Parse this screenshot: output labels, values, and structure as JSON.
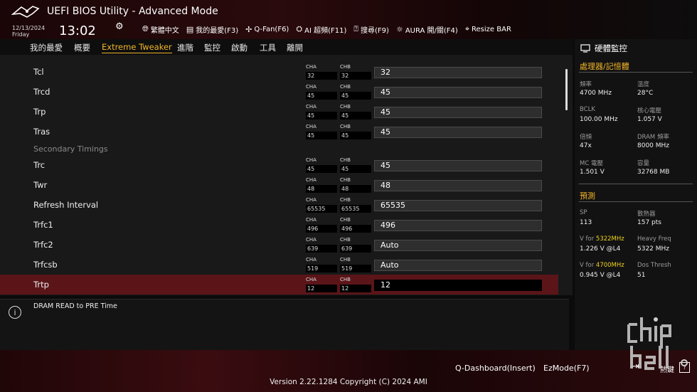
{
  "header": {
    "title": "UEFI BIOS Utility - Advanced Mode",
    "date": "12/13/2024",
    "day": "Friday",
    "time": "13:02",
    "toolbar": [
      {
        "icon": "globe-icon",
        "label": "繁體中文"
      },
      {
        "icon": "favorites-icon",
        "label": "我的最愛(F3)"
      },
      {
        "icon": "fan-icon",
        "label": "Q-Fan(F6)"
      },
      {
        "icon": "ai-overclock-icon",
        "label": "AI 超頻(F11)"
      },
      {
        "icon": "help-search-icon",
        "label": "搜尋(F9)"
      },
      {
        "icon": "aura-icon",
        "label": "AURA 開/關(F4)"
      },
      {
        "icon": "resize-bar-icon",
        "label": "Resize BAR"
      }
    ]
  },
  "menu": {
    "items": [
      "我的最愛",
      "概要",
      "Extreme Tweaker",
      "進階",
      "監控",
      "啟動",
      "工具",
      "離開"
    ],
    "active": "Extreme Tweaker"
  },
  "main": {
    "channel_a": "CHA",
    "channel_b": "CHB",
    "section_label": "Secondary Timings",
    "rows": [
      {
        "label": "Tcl",
        "cha": "32",
        "chb": "32",
        "value": "32"
      },
      {
        "label": "Trcd",
        "cha": "45",
        "chb": "45",
        "value": "45"
      },
      {
        "label": "Trp",
        "cha": "45",
        "chb": "45",
        "value": "45"
      },
      {
        "label": "Tras",
        "cha": "45",
        "chb": "45",
        "value": "45"
      },
      {
        "label": "Trc",
        "cha": "45",
        "chb": "45",
        "value": "45"
      },
      {
        "label": "Twr",
        "cha": "48",
        "chb": "48",
        "value": "48"
      },
      {
        "label": "Refresh Interval",
        "cha": "65535",
        "chb": "65535",
        "value": "65535"
      },
      {
        "label": "Trfc1",
        "cha": "496",
        "chb": "496",
        "value": "496"
      },
      {
        "label": "Trfc2",
        "cha": "639",
        "chb": "639",
        "value": "Auto"
      },
      {
        "label": "Trfcsb",
        "cha": "519",
        "chb": "519",
        "value": "Auto"
      },
      {
        "label": "Trtp",
        "cha": "12",
        "chb": "12",
        "value": "12"
      }
    ],
    "selected_row": "Trtp"
  },
  "description": "DRAM READ to PRE Time",
  "monitor": {
    "title": "硬體監控",
    "cpu_section": "處理器/記憶體",
    "cpu_items": [
      {
        "label": "頻率",
        "value": "4700 MHz"
      },
      {
        "label": "溫度",
        "value": "28°C"
      },
      {
        "label": "BCLK",
        "value": "100.00 MHz"
      },
      {
        "label": "核心電壓",
        "value": "1.057 V"
      },
      {
        "label": "倍頻",
        "value": "47x"
      },
      {
        "label": "DRAM 頻率",
        "value": "8000 MHz"
      },
      {
        "label": "MC 電壓",
        "value": "1.501 V"
      },
      {
        "label": "容量",
        "value": "32768 MB"
      }
    ],
    "predict_section": "預測",
    "predict_items": [
      {
        "label": "SP",
        "value": "113"
      },
      {
        "label": "散熱器",
        "value": "157 pts"
      },
      {
        "label_prefix": "V for ",
        "label_hl": "5322MHz",
        "value": "1.226 V @L4"
      },
      {
        "label": "Heavy Freq",
        "value": "5322 MHz"
      },
      {
        "label_prefix": "V for ",
        "label_hl": "4700MHz",
        "value": "0.945 V @L4"
      },
      {
        "label": "Dos Thresh",
        "value": "51"
      }
    ]
  },
  "footer": {
    "qdashboard": "Q-Dashboard(Insert)",
    "ez_mode": "EzMode(F7)",
    "search": "熱鍵",
    "search_key": "?",
    "version": "Version 2.22.1284 Copyright (C) 2024 AMI",
    "watermark": "www.chiphell.com"
  },
  "colors": {
    "accent": "#f0b429",
    "selected_row": "#5b1519",
    "highlight": "#f0d21c"
  }
}
